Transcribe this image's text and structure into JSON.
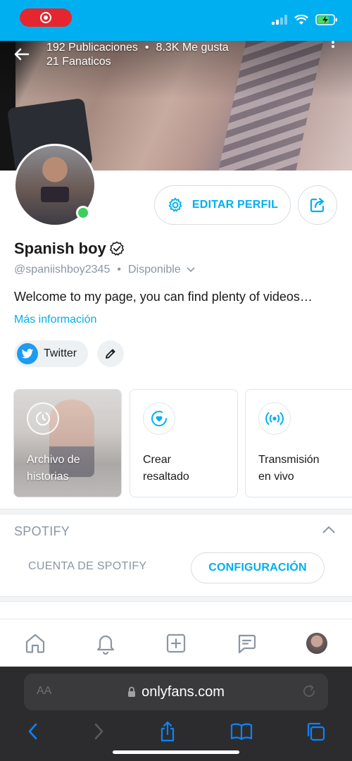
{
  "status_bar": {
    "recording_icon": "record-icon",
    "signal_icon": "cellular-signal-icon",
    "wifi_icon": "wifi-icon",
    "battery_icon": "battery-charging-icon"
  },
  "cover": {
    "posts": "192 Publicaciones",
    "likes": "8.3K Me gusta",
    "fans": "21 Fanaticos"
  },
  "profile": {
    "name": "Spanish boy",
    "handle": "@spaniishboy2345",
    "separator": "•",
    "availability": "Disponible",
    "bio": "Welcome to my page, you can find plenty of videos…",
    "more_info": "Más información",
    "edit_label": "EDITAR PERFIL",
    "online_color": "#3ccf5c"
  },
  "links": {
    "twitter_label": "Twitter"
  },
  "highlights": [
    {
      "label_line1": "Archivo de",
      "label_line2": "historias"
    },
    {
      "label_line1": "Crear",
      "label_line2": "resaltado"
    },
    {
      "label_line1": "Transmisión",
      "label_line2": "en vivo"
    }
  ],
  "spotify": {
    "title": "SPOTIFY",
    "account_label": "CUENTA DE SPOTIFY",
    "config_label": "CONFIGURACIÓN"
  },
  "bottom_nav": [
    "home-icon",
    "bell-icon",
    "add-post-icon",
    "messages-icon",
    "profile-avatar"
  ],
  "browser": {
    "text_size": "AA",
    "url": "onlyfans.com"
  },
  "colors": {
    "accent": "#00aff0",
    "muted": "#8a96a3",
    "status_bar": "#00aff0"
  }
}
